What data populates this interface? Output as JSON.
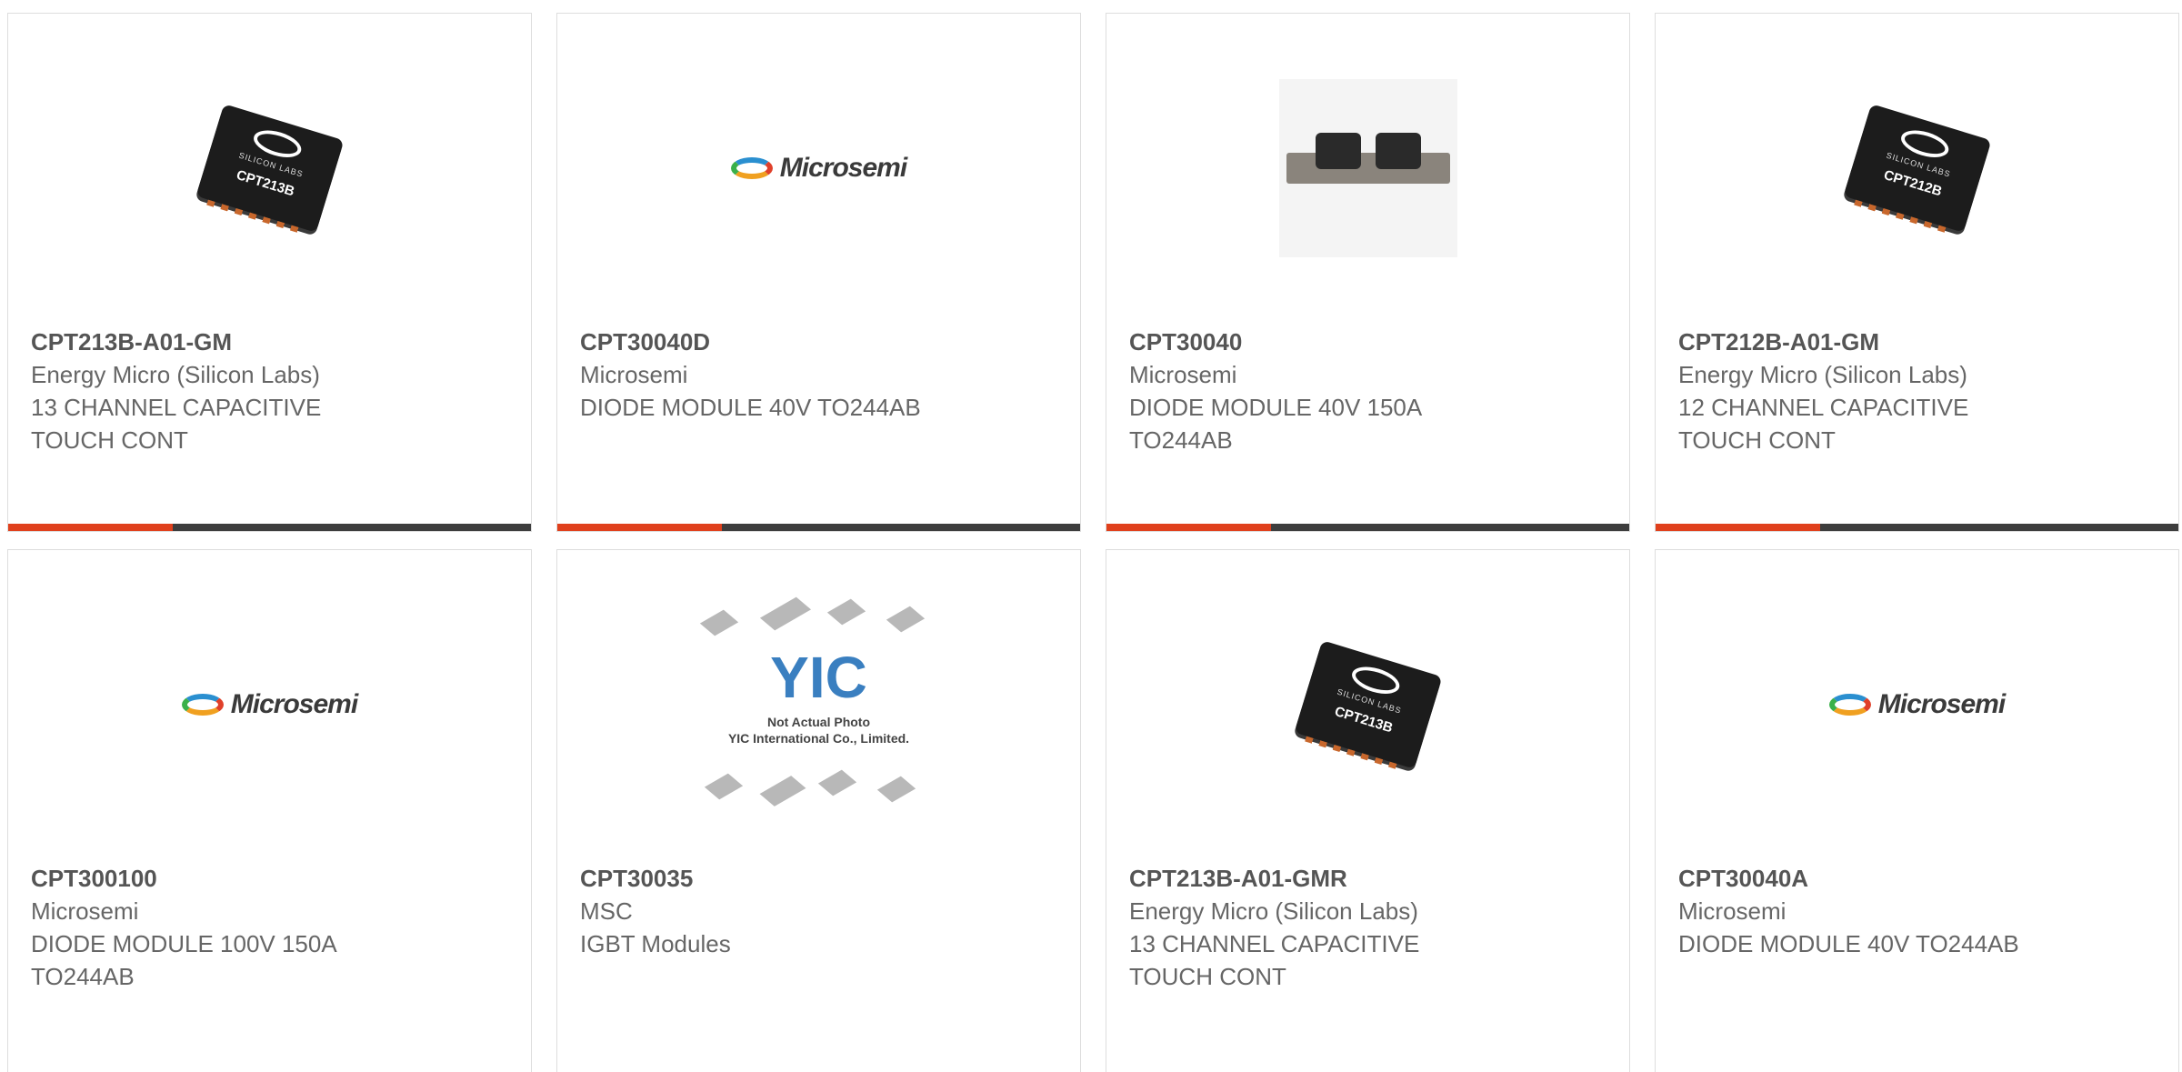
{
  "colors": {
    "accent": "#e0401c",
    "bar": "#3d3d3d",
    "text": "#666666",
    "border": "#dddddd"
  },
  "products": [
    {
      "part": "CPT213B-A01-GM",
      "manufacturer": "Energy Micro (Silicon Labs)",
      "description": "13 CHANNEL CAPACITIVE TOUCH CONT",
      "image": "silabs-chip-image",
      "chip_brand": "SILICON LABS",
      "chip_code": "CPT213B"
    },
    {
      "part": "CPT30040D",
      "manufacturer": "Microsemi",
      "description": "DIODE MODULE 40V TO244AB",
      "image": "microsemi-logo-image",
      "logo_text": "Microsemi"
    },
    {
      "part": "CPT30040",
      "manufacturer": "Microsemi",
      "description": "DIODE MODULE 40V 150A TO244AB",
      "image": "diode-module-image"
    },
    {
      "part": "CPT212B-A01-GM",
      "manufacturer": "Energy Micro (Silicon Labs)",
      "description": "12 CHANNEL CAPACITIVE TOUCH CONT",
      "image": "silabs-chip-image",
      "chip_brand": "SILICON LABS",
      "chip_code": "CPT212B"
    },
    {
      "part": "CPT300100",
      "manufacturer": "Microsemi",
      "description": "DIODE MODULE 100V 150A TO244AB",
      "image": "microsemi-logo-image",
      "logo_text": "Microsemi"
    },
    {
      "part": "CPT30035",
      "manufacturer": "MSC",
      "description": "IGBT Modules",
      "image": "placeholder-not-actual-photo",
      "placeholder_mark": "YIC",
      "placeholder_line1": "Not Actual Photo",
      "placeholder_line2": "YIC International Co., Limited."
    },
    {
      "part": "CPT213B-A01-GMR",
      "manufacturer": "Energy Micro (Silicon Labs)",
      "description": "13 CHANNEL CAPACITIVE TOUCH CONT",
      "image": "silabs-chip-image",
      "chip_brand": "SILICON LABS",
      "chip_code": "CPT213B"
    },
    {
      "part": "CPT30040A",
      "manufacturer": "Microsemi",
      "description": "DIODE MODULE 40V TO244AB",
      "image": "microsemi-logo-image",
      "logo_text": "Microsemi"
    }
  ]
}
